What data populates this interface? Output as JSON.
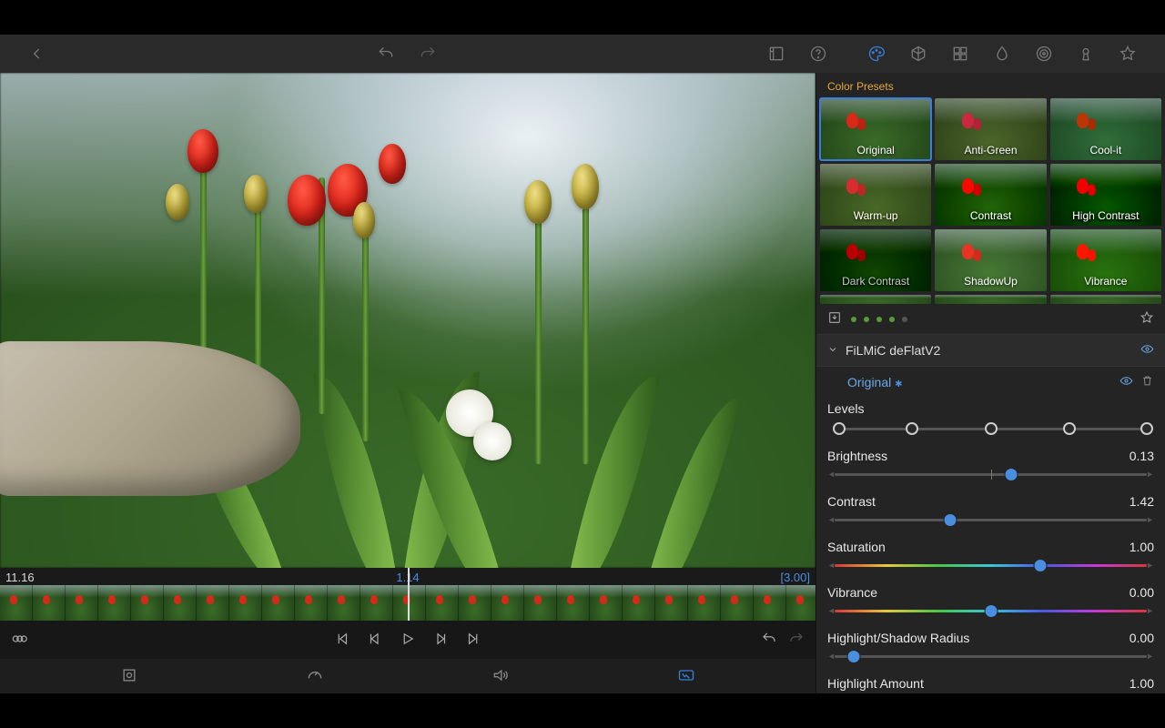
{
  "topbar": {
    "icons": [
      "back",
      "undo",
      "redo",
      "library",
      "help",
      "color",
      "cube",
      "grid",
      "drop",
      "spiral",
      "key",
      "star"
    ],
    "active": "color"
  },
  "presets": {
    "header": "Color Presets",
    "items": [
      {
        "label": "Original",
        "cls": "",
        "selected": true
      },
      {
        "label": "Anti-Green",
        "cls": "f-antigreen"
      },
      {
        "label": "Cool-it",
        "cls": "f-coolit"
      },
      {
        "label": "Warm-up",
        "cls": "f-warmup"
      },
      {
        "label": "Contrast",
        "cls": "f-contrast"
      },
      {
        "label": "High Contrast",
        "cls": "f-highcontrast"
      },
      {
        "label": "Dark Contrast",
        "cls": "f-darkcontrast"
      },
      {
        "label": "ShadowUp",
        "cls": "f-shadowup"
      },
      {
        "label": "Vibrance",
        "cls": "f-vibrance"
      }
    ],
    "page_dots": [
      true,
      true,
      true,
      true,
      false
    ]
  },
  "lut": {
    "name": "FiLMiC deFlatV2"
  },
  "current_preset": {
    "name": "Original"
  },
  "timeline": {
    "left": "11.16",
    "mid": "1.14",
    "right": "[3.00]",
    "frame_count": 25
  },
  "params": {
    "levels": {
      "label": "Levels",
      "stops": [
        0.02,
        0.25,
        0.5,
        0.75,
        0.995
      ]
    },
    "brightness": {
      "label": "Brightness",
      "value": "0.13",
      "pos": 0.565,
      "center": true
    },
    "contrast": {
      "label": "Contrast",
      "value": "1.42",
      "pos": 0.37,
      "center": false
    },
    "saturation": {
      "label": "Saturation",
      "value": "1.00",
      "pos": 0.66,
      "rainbow": true
    },
    "vibrance": {
      "label": "Vibrance",
      "value": "0.00",
      "pos": 0.5,
      "rainbow": true,
      "center": true
    },
    "hsradius": {
      "label": "Highlight/Shadow Radius",
      "value": "0.00",
      "pos": 0.06
    },
    "hamount": {
      "label": "Highlight Amount",
      "value": "1.00"
    }
  }
}
